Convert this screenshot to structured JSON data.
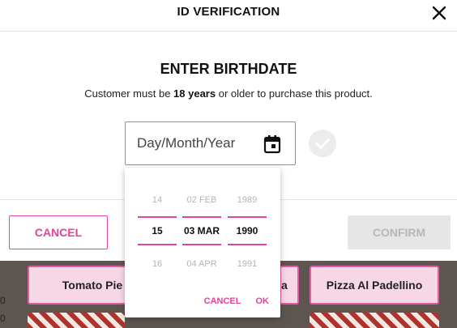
{
  "modal": {
    "title": "ID VERIFICATION",
    "heading": "ENTER BIRTHDATE",
    "subtext_prefix": "Customer must be ",
    "subtext_bold": "18 years",
    "subtext_suffix": " or older to purchase this product.",
    "date_placeholder": "Day/Month/Year",
    "cancel_label": "CANCEL",
    "confirm_label": "CONFIRM"
  },
  "picker": {
    "day": {
      "prev": "14",
      "selected": "15",
      "next": "16"
    },
    "month": {
      "prev": "02 FEB",
      "selected": "03 MAR",
      "next": "04 APR"
    },
    "year": {
      "prev": "1989",
      "selected": "1990",
      "next": "1991"
    },
    "cancel_label": "CANCEL",
    "ok_label": "OK"
  },
  "background": {
    "tiles": [
      "Tomato Pie",
      "a",
      "Pizza Al Padellino"
    ],
    "edge_text": [
      "0",
      "0"
    ]
  },
  "colors": {
    "accent": "#e0459a",
    "disabled_bg": "#e6e6e6",
    "disabled_text": "#b7b7b7"
  },
  "icons": [
    "close-icon",
    "calendar-icon",
    "check-circle-icon"
  ]
}
